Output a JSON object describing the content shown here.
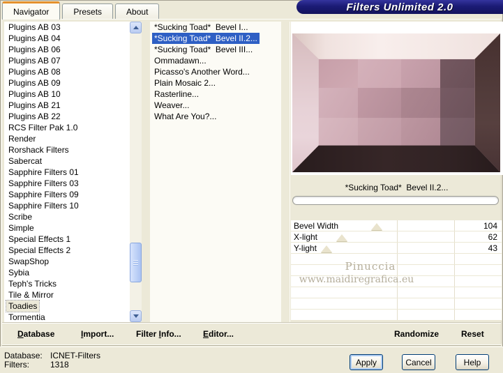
{
  "window": {
    "title": "Filters Unlimited 2.0"
  },
  "tabs": [
    {
      "label": "Navigator",
      "active": true
    },
    {
      "label": "Presets",
      "active": false
    },
    {
      "label": "About",
      "active": false
    }
  ],
  "category_list": {
    "items": [
      {
        "label": "Plugins AB 03"
      },
      {
        "label": "Plugins AB 04"
      },
      {
        "label": "Plugins AB 06"
      },
      {
        "label": "Plugins AB 07"
      },
      {
        "label": "Plugins AB 08"
      },
      {
        "label": "Plugins AB 09"
      },
      {
        "label": "Plugins AB 10"
      },
      {
        "label": "Plugins AB 21"
      },
      {
        "label": "Plugins AB 22"
      },
      {
        "label": "RCS Filter Pak 1.0"
      },
      {
        "label": "Render"
      },
      {
        "label": "Rorshack Filters"
      },
      {
        "label": "Sabercat"
      },
      {
        "label": "Sapphire Filters 01"
      },
      {
        "label": "Sapphire Filters 03"
      },
      {
        "label": "Sapphire Filters 09"
      },
      {
        "label": "Sapphire Filters 10"
      },
      {
        "label": "Scribe"
      },
      {
        "label": "Simple"
      },
      {
        "label": "Special Effects 1"
      },
      {
        "label": "Special Effects 2"
      },
      {
        "label": "SwapShop"
      },
      {
        "label": "Sybia"
      },
      {
        "label": "Teph's Tricks"
      },
      {
        "label": "Tile & Mirror"
      },
      {
        "label": "Toadies",
        "selected": true
      },
      {
        "label": "Tormentia"
      }
    ]
  },
  "filter_list": {
    "items": [
      {
        "label": "*Sucking Toad*  Bevel I..."
      },
      {
        "label": "*Sucking Toad*  Bevel II.2...",
        "selected": true
      },
      {
        "label": "*Sucking Toad*  Bevel III..."
      },
      {
        "label": "Ommadawn..."
      },
      {
        "label": "Picasso's Another Word..."
      },
      {
        "label": "Plain Mosaic 2..."
      },
      {
        "label": "Rasterline..."
      },
      {
        "label": "Weaver..."
      },
      {
        "label": "What Are You?..."
      }
    ]
  },
  "preview": {
    "caption": "*Sucking Toad*  Bevel II.2...",
    "watermark_line1": "Pinuccia",
    "watermark_line2": "www.maidiregrafica.eu"
  },
  "sliders": [
    {
      "label": "Bevel Width",
      "value": "104",
      "thumb_left": "40.8%"
    },
    {
      "label": "X-light",
      "value": "62",
      "thumb_left": "24.3%"
    },
    {
      "label": "Y-light",
      "value": "43",
      "thumb_left": "16.9%"
    }
  ],
  "toolbar": {
    "database": {
      "key": "D",
      "rest": "atabase"
    },
    "import": {
      "key": "I",
      "rest": "mport..."
    },
    "filter_info": {
      "pre": "Filter ",
      "key": "I",
      "rest": "nfo..."
    },
    "editor": {
      "key": "E",
      "rest": "ditor..."
    },
    "randomize": "Randomize",
    "reset": "Reset"
  },
  "status": {
    "database_label": "Database:",
    "database_value": "ICNET-Filters",
    "filters_label": "Filters:",
    "filters_value": "1318"
  },
  "actions": {
    "apply": "Apply",
    "cancel": "Cancel",
    "help": "Help"
  },
  "colors": {
    "dialog_bg": "#ECE9D8",
    "title_bg": "#1B1B75",
    "selection_blue": "#2E5FC4",
    "tab_accent_orange": "#E5912D",
    "watermark_gray": "#B5AE9B"
  }
}
